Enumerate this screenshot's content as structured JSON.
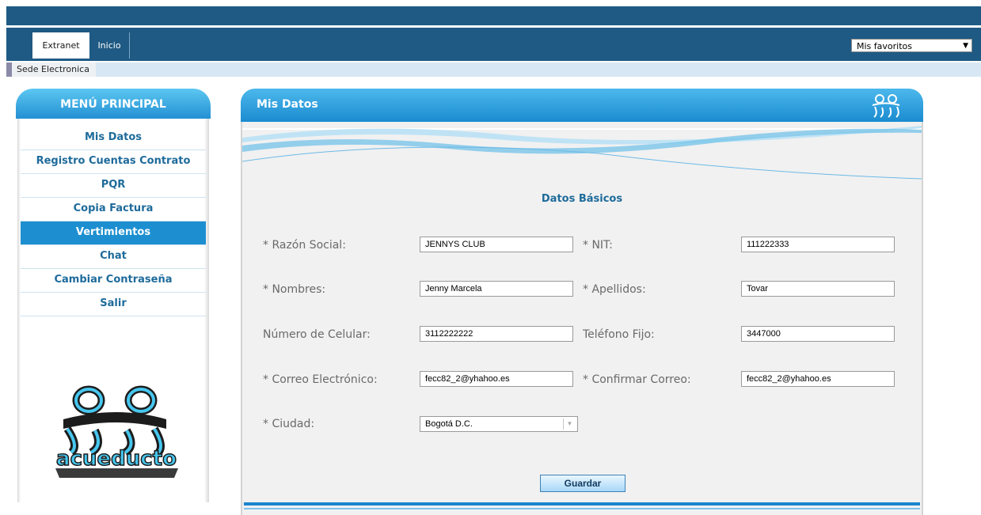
{
  "header": {
    "tabs": [
      {
        "label": "Extranet"
      },
      {
        "label": "Inicio"
      }
    ],
    "favorites": {
      "selected": "Mis favoritos"
    },
    "subtab": "Sede Electronica"
  },
  "sidebar": {
    "title": "MENÚ PRINCIPAL",
    "items": [
      {
        "label": "Mis Datos"
      },
      {
        "label": "Registro Cuentas Contrato"
      },
      {
        "label": "PQR"
      },
      {
        "label": "Copia Factura"
      },
      {
        "label": "Vertimientos"
      },
      {
        "label": "Chat"
      },
      {
        "label": "Cambiar Contraseña"
      },
      {
        "label": "Salir"
      }
    ],
    "active_item": "Vertimientos",
    "logo_text": "acueducto"
  },
  "main": {
    "title": "Mis Datos",
    "section_title": "Datos Básicos",
    "fields": {
      "razon_social": {
        "label": "* Razón Social:",
        "value": "JENNYS CLUB"
      },
      "nit": {
        "label": "* NIT:",
        "value": "111222333"
      },
      "nombres": {
        "label": "* Nombres:",
        "value": "Jenny Marcela"
      },
      "apellidos": {
        "label": "* Apellidos:",
        "value": "Tovar"
      },
      "celular": {
        "label": "Número de Celular:",
        "value": "3112222222"
      },
      "telefono": {
        "label": "Teléfono Fijo:",
        "value": "3447000"
      },
      "correo": {
        "label": "* Correo Electrónico:",
        "value": "fecc82_2@yhahoo.es"
      },
      "confirmar_correo": {
        "label": "* Confirmar Correo:",
        "value": "fecc82_2@yhahoo.es"
      },
      "ciudad": {
        "label": "* Ciudad:",
        "value": "Bogotá D.C."
      }
    },
    "save_label": "Guardar"
  },
  "colors": {
    "brand_dark": "#1e5a84",
    "accent": "#1d8fd0",
    "menu_text": "#1e6b9b"
  }
}
